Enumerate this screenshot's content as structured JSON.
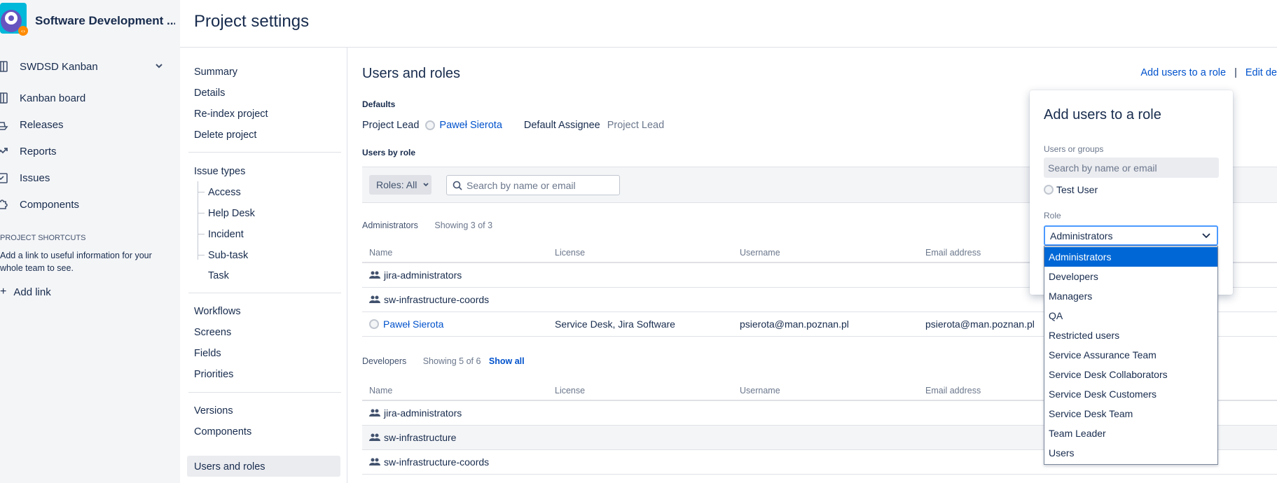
{
  "project": {
    "name": "Software Development ..."
  },
  "sidebar": {
    "board": {
      "label": "SWDSD Kanban"
    },
    "items": [
      {
        "label": "Kanban board",
        "icon": "board-icon"
      },
      {
        "label": "Releases",
        "icon": "ship-icon"
      },
      {
        "label": "Reports",
        "icon": "chart-icon"
      },
      {
        "label": "Issues",
        "icon": "issues-icon"
      },
      {
        "label": "Components",
        "icon": "puzzle-icon"
      }
    ],
    "shortcuts_title": "PROJECT SHORTCUTS",
    "shortcuts_desc": "Add a link to useful information for your whole team to see.",
    "add_link": "Add link"
  },
  "header": {
    "title": "Project settings"
  },
  "settings_nav": {
    "group1": [
      "Summary",
      "Details",
      "Re-index project",
      "Delete project"
    ],
    "issue_types": "Issue types",
    "issue_type_children": [
      "Access",
      "Help Desk",
      "Incident",
      "Sub-task",
      "Task"
    ],
    "group3": [
      "Workflows",
      "Screens",
      "Fields",
      "Priorities"
    ],
    "group4": [
      "Versions",
      "Components"
    ],
    "active": "Users and roles"
  },
  "main": {
    "title": "Users and roles",
    "add_users_link": "Add users to a role",
    "edit_link": "Edit de",
    "defaults_label": "Defaults",
    "project_lead_label": "Project Lead",
    "project_lead_value": "Paweł Sierota",
    "default_assignee_label": "Default Assignee",
    "default_assignee_value": "Project Lead",
    "users_by_role_label": "Users by role",
    "roles_filter": "Roles: All",
    "search_placeholder": "Search by name or email",
    "columns": [
      "Name",
      "License",
      "Username",
      "Email address"
    ],
    "administrators": {
      "name": "Administrators",
      "count": "Showing 3 of 3",
      "rows": [
        {
          "name": "jira-administrators",
          "type": "group",
          "license": "",
          "username": "",
          "email": ""
        },
        {
          "name": "sw-infrastructure-coords",
          "type": "group",
          "license": "",
          "username": "",
          "email": ""
        },
        {
          "name": "Paweł Sierota",
          "type": "user",
          "license": "Service Desk, Jira Software",
          "username": "psierota@man.poznan.pl",
          "email": "psierota@man.poznan.pl"
        }
      ]
    },
    "developers": {
      "name": "Developers",
      "count": "Showing 5 of 6",
      "show_all": "Show all",
      "rows": [
        {
          "name": "jira-administrators",
          "type": "group"
        },
        {
          "name": "sw-infrastructure",
          "type": "group"
        },
        {
          "name": "sw-infrastructure-coords",
          "type": "group"
        }
      ]
    }
  },
  "dialog": {
    "title": "Add users to a role",
    "users_label": "Users or groups",
    "users_placeholder": "Search by name or email",
    "selected_user": "Test User",
    "role_label": "Role",
    "role_value": "Administrators",
    "options": [
      "Administrators",
      "Developers",
      "Managers",
      "QA",
      "Restricted users",
      "Service Assurance Team",
      "Service Desk Collaborators",
      "Service Desk Customers",
      "Service Desk Team",
      "Team Leader",
      "Users"
    ]
  },
  "colors": {
    "accent": "#0052cc",
    "selected": "#0067d6",
    "sidebar_bg": "#f4f5f7"
  }
}
